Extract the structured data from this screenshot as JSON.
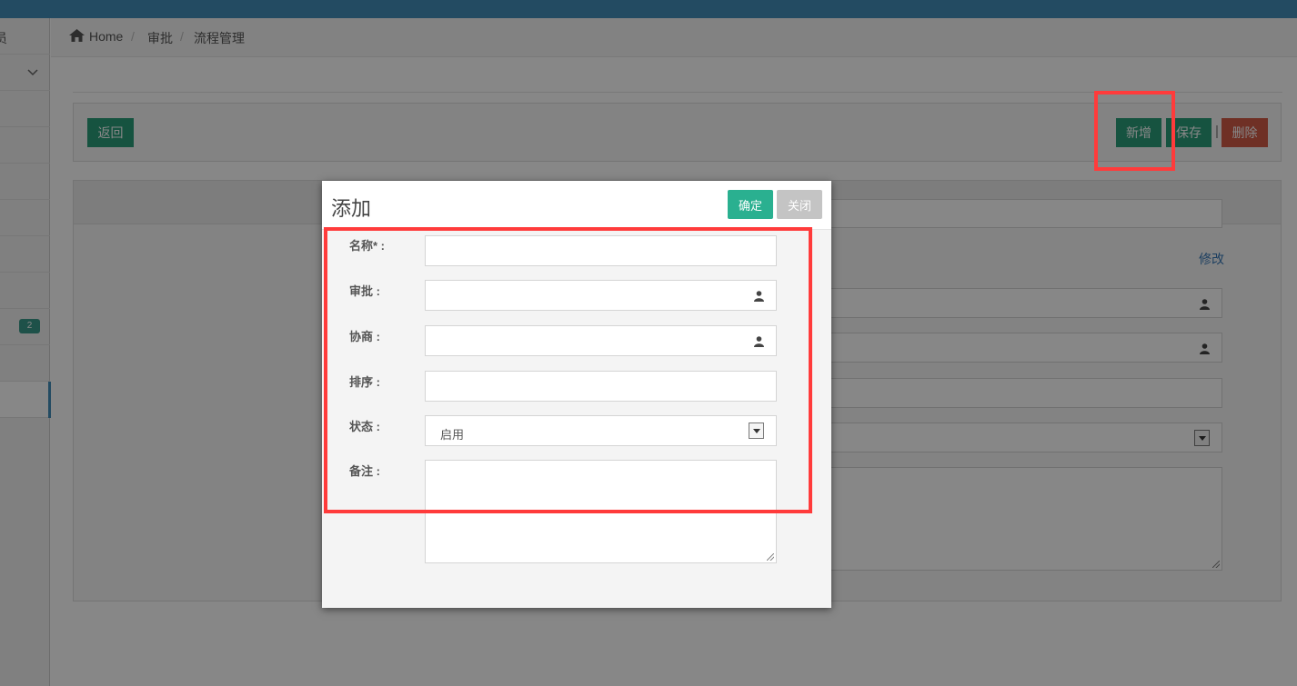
{
  "sidebar": {
    "header_text": "员",
    "badge": "2"
  },
  "breadcrumb": {
    "items": [
      "Home",
      "审批",
      "流程管理"
    ],
    "separator": "/"
  },
  "toolbar": {
    "back_label": "返回",
    "add_label": "新增",
    "save_label": "保存",
    "delete_label": "删除"
  },
  "panel": {
    "edit_link": "修改"
  },
  "modal": {
    "title": "添加",
    "confirm_label": "确定",
    "close_label": "关闭",
    "fields": {
      "name_label": "名称* :",
      "approve_label": "审批 :",
      "consult_label": "协商 :",
      "sort_label": "排序 :",
      "status_label": "状态 :",
      "status_value": "启用",
      "remark_label": "备注 :"
    }
  },
  "colors": {
    "topbar": "#438eb9",
    "primary_button": "#2a9d7a",
    "danger_button": "#d15b47",
    "highlight_box": "#ff3b3b"
  },
  "icons": {
    "home": "home-icon",
    "person": "user-icon",
    "chevron": "chevron-down-icon"
  }
}
